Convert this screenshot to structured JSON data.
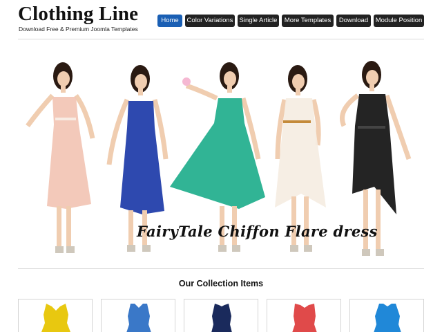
{
  "header": {
    "title": "Clothing Line",
    "subtitle": "Download Free & Premium Joomla Templates"
  },
  "nav": {
    "items": [
      {
        "label": "Home",
        "active": true
      },
      {
        "label": "Color Variations",
        "active": false
      },
      {
        "label": "Single Article",
        "active": false
      },
      {
        "label": "More Templates",
        "active": false
      },
      {
        "label": "Download",
        "active": false
      },
      {
        "label": "Module Position",
        "active": false
      }
    ]
  },
  "hero": {
    "caption": "FairyTale Chiffon Flare dress",
    "dress_colors": [
      "#f2c4b4",
      "#1c3aa8",
      "#1fae8c",
      "#f5ede2",
      "#111111"
    ]
  },
  "collection": {
    "title": "Our Collection Items",
    "item_colors": [
      "#e8c810",
      "#3a78c8",
      "#1a2a5c",
      "#e04a4a",
      "#2088d8"
    ]
  }
}
